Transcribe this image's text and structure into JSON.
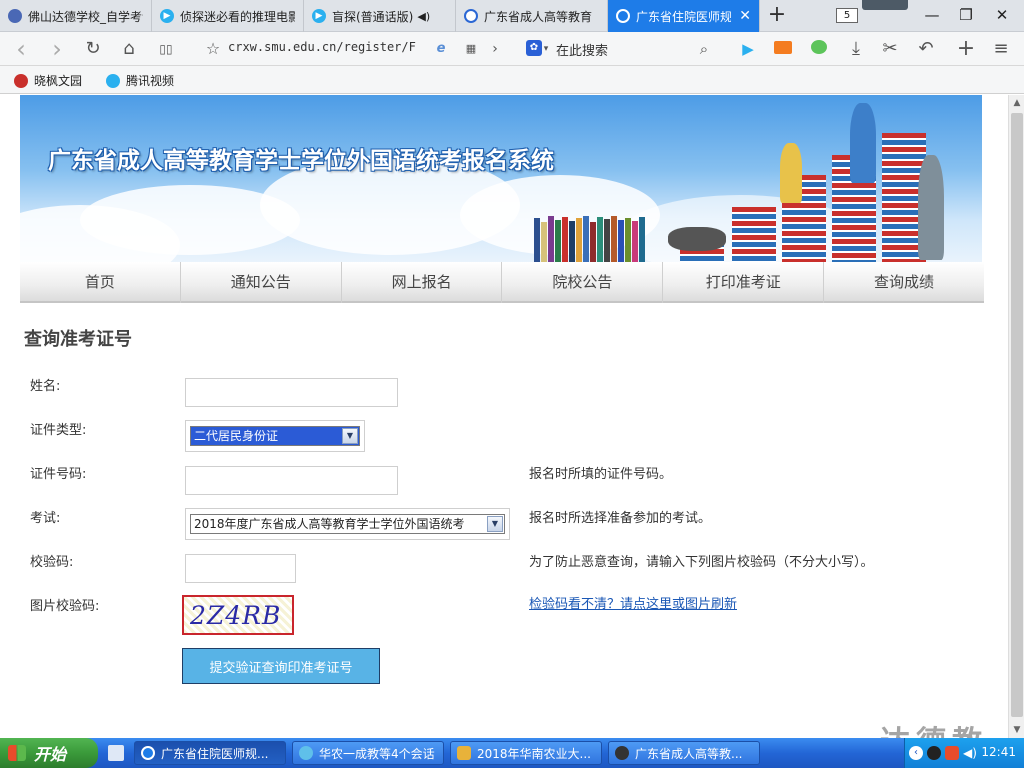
{
  "browser": {
    "tabs": [
      {
        "title": "佛山达德学校_自学考试",
        "icon_color": "#4a68b5",
        "active": false
      },
      {
        "title": "侦探迷必看的推理电影",
        "icon_color": "#2ab0ef",
        "active": false
      },
      {
        "title": "盲探(普通话版)",
        "icon_color": "#2ab0ef",
        "active": false,
        "audio_icon": "speaker-icon"
      },
      {
        "title": "广东省成人高等教育",
        "icon_color": "#2b67d4",
        "active": false
      },
      {
        "title": "广东省住院医师规范化",
        "icon_color": "#ffffff",
        "active": true
      }
    ],
    "new_tab_label": "+",
    "tab_count": "5",
    "window_controls": {
      "minimize": "—",
      "maximize": "❐",
      "close": "✕"
    },
    "nav": {
      "back": "‹",
      "forward": "›",
      "reload": "↻",
      "home": "⌂",
      "reader": "▯▯",
      "star": "☆"
    },
    "address": "crxw.smu.edu.cn/register/F",
    "search_engine_icon": "paw-icon",
    "search_placeholder": "在此搜索",
    "toolbar_icons": [
      "play-icon",
      "video-icon",
      "chat-icon",
      "download-icon",
      "scissors-icon",
      "undo-icon",
      "plus-icon",
      "menu-icon"
    ]
  },
  "bookmarks": [
    {
      "label": "晓枫文园",
      "icon_color": "#c9302c"
    },
    {
      "label": "腾讯视频",
      "icon_color": "#2ab0ef"
    }
  ],
  "banner": {
    "title": "广东省成人高等教育学士学位外国语统考报名系统"
  },
  "nav_menu": [
    "首页",
    "通知公告",
    "网上报名",
    "院校公告",
    "打印准考证",
    "查询成绩"
  ],
  "form": {
    "heading": "查询准考证号",
    "name": {
      "label": "姓名:",
      "value": ""
    },
    "id_type": {
      "label": "证件类型:",
      "selected": "二代居民身份证"
    },
    "id_number": {
      "label": "证件号码:",
      "value": "",
      "hint": "报名时所填的证件号码。"
    },
    "exam": {
      "label": "考试:",
      "selected": "2018年度广东省成人高等教育学士学位外国语统考",
      "hint": "报名时所选择准备参加的考试。"
    },
    "verify_code": {
      "label": "校验码:",
      "value": "",
      "hint": "为了防止恶意查询，请输入下列图片校验码（不分大小写）。"
    },
    "image_code": {
      "label": "图片校验码:",
      "captcha_text": "2Z4RB",
      "refresh_link": "检验码看不清？请点这里或图片刷新"
    },
    "submit_label": "提交验证查询印准考证号"
  },
  "watermark": "达德教育",
  "taskbar": {
    "start_label": "开始",
    "tasks": [
      {
        "label": "广东省住院医师规...",
        "icon_color": "#1e7ce8",
        "active": true
      },
      {
        "label": "华农一成教等4个会话",
        "icon_color": "#5fc0ea",
        "active": false
      },
      {
        "label": "2018年华南农业大...",
        "icon_color": "#e8b23a",
        "active": false
      },
      {
        "label": "广东省成人高等教...",
        "icon_color": "#333333",
        "active": false
      }
    ],
    "clock": "12:41"
  }
}
